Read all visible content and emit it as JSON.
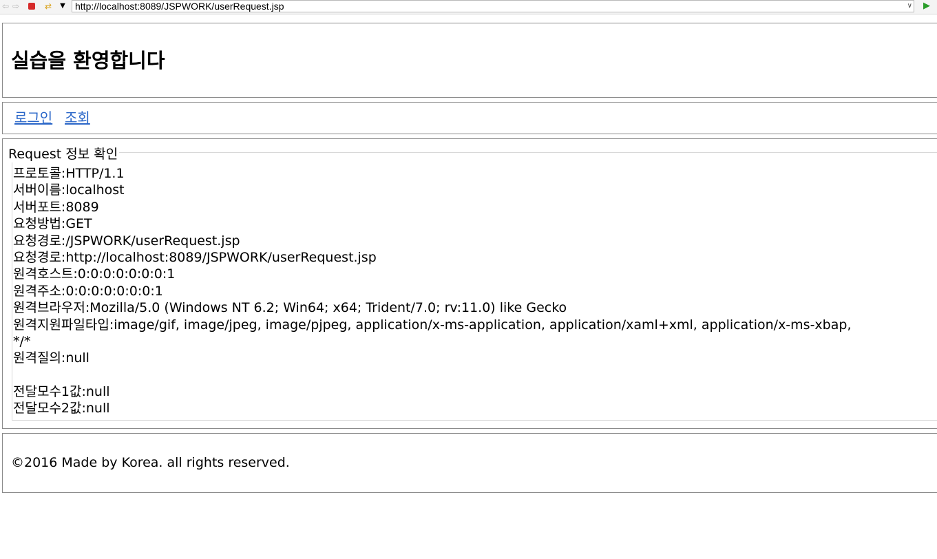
{
  "browser": {
    "url": "http://localhost:8089/JSPWORK/userRequest.jsp",
    "icons": [
      "back-arrow-icon",
      "forward-arrow-icon",
      "stop-icon",
      "refresh-icon",
      "dropdown-icon",
      "go-icon"
    ]
  },
  "header": {
    "title": "실습을 환영합니다"
  },
  "nav": {
    "login_label": "로그인",
    "view_label": "조회"
  },
  "request": {
    "legend": "Request 정보 확인",
    "lines": [
      "프로토콜:HTTP/1.1",
      "서버이름:localhost",
      "서버포트:8089",
      "요청방법:GET",
      "요청경로:/JSPWORK/userRequest.jsp",
      "요청경로:http://localhost:8089/JSPWORK/userRequest.jsp",
      "원격호스트:0:0:0:0:0:0:0:1",
      "원격주소:0:0:0:0:0:0:0:1",
      "원격브라우저:Mozilla/5.0 (Windows NT 6.2; Win64; x64; Trident/7.0; rv:11.0) like Gecko",
      "원격지원파일타입:image/gif, image/jpeg, image/pjpeg, application/x-ms-application, application/xaml+xml, application/x-ms-xbap,",
      "*/*",
      "원격질의:null",
      "",
      "전달모수1값:null",
      "전달모수2값:null"
    ]
  },
  "footer": {
    "text": "©2016 Made by Korea. all rights reserved."
  }
}
